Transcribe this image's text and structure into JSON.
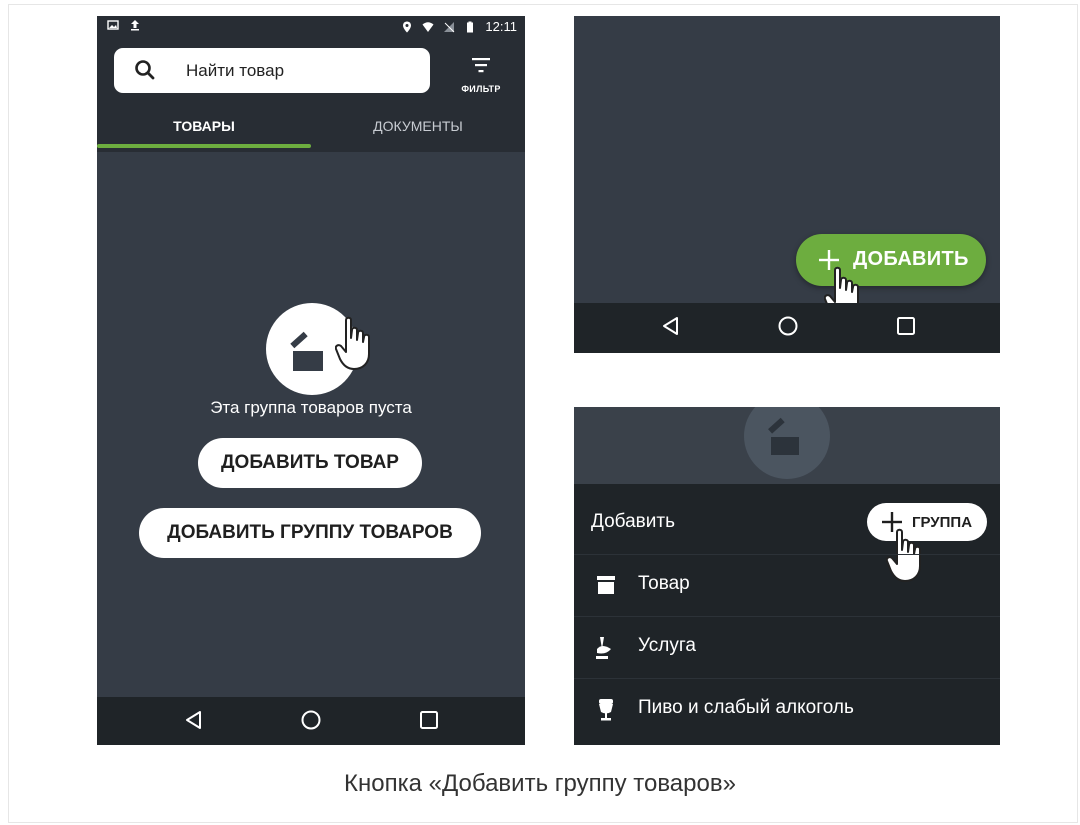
{
  "left_screen": {
    "status_bar": {
      "time": "12:11"
    },
    "search": {
      "placeholder": "Найти товар"
    },
    "filter": {
      "label": "ФИЛЬТР"
    },
    "tabs": [
      {
        "label": "ТОВАРЫ",
        "active": true
      },
      {
        "label": "ДОКУМЕНТЫ",
        "active": false
      }
    ],
    "empty_state": {
      "message": "Эта группа товаров пуста",
      "add_product_button": "ДОБАВИТЬ ТОВАР",
      "add_group_button": "ДОБАВИТЬ ГРУППУ ТОВАРОВ"
    }
  },
  "right_top_screen": {
    "fab_label": "ДОБАВИТЬ"
  },
  "right_bottom_screen": {
    "sheet_title": "Добавить",
    "group_chip_label": "ГРУППА",
    "menu_items": [
      {
        "label": "Товар",
        "icon": "box-icon"
      },
      {
        "label": "Услуга",
        "icon": "service-icon"
      },
      {
        "label": "Пиво и слабый алкоголь",
        "icon": "beer-icon"
      }
    ]
  },
  "caption": "Кнопка «Добавить группу товаров»",
  "colors": {
    "accent_green": "#6dad3f",
    "dark_bg": "#353c46",
    "bar_bg": "#282d34",
    "navbar_bg": "#1f2428"
  }
}
